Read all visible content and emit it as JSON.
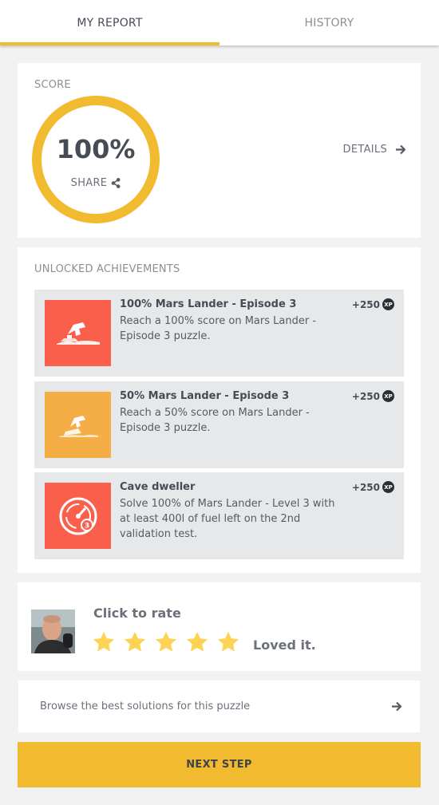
{
  "tabs": [
    {
      "label": "MY REPORT",
      "active": true
    },
    {
      "label": "HISTORY",
      "active": false
    }
  ],
  "score": {
    "label": "SCORE",
    "value": "100%",
    "share_label": "SHARE",
    "details_label": "DETAILS",
    "ring_color": "#f2bb2f"
  },
  "achievements": {
    "label": "UNLOCKED ACHIEVEMENTS",
    "items": [
      {
        "title": "100% Mars Lander - Episode 3",
        "description": "Reach a 100% score on Mars Lander - Episode 3 puzzle.",
        "xp": "+250",
        "icon": "mars-lander-icon",
        "color": "#fa5f4b"
      },
      {
        "title": "50% Mars Lander - Episode 3",
        "description": "Reach a 50% score on Mars Lander - Episode 3 puzzle.",
        "xp": "+250",
        "icon": "mars-lander-icon",
        "color": "#f5ae45"
      },
      {
        "title": "Cave dweller",
        "description": "Solve 100% of Mars Lander - Level 3 with at least 400l of fuel left on the 2nd validation test.",
        "xp": "+250",
        "icon": "fuel-gauge-icon",
        "color": "#fa5f4b"
      }
    ],
    "xp_badge": "XP"
  },
  "rating": {
    "title": "Click to rate",
    "stars": 5,
    "max_stars": 5,
    "star_color": "#fdd354",
    "verdict": "Loved it."
  },
  "browse": {
    "text": "Browse the best solutions for this puzzle"
  },
  "next_step": {
    "label": "NEXT STEP",
    "color": "#f2bb2f"
  }
}
